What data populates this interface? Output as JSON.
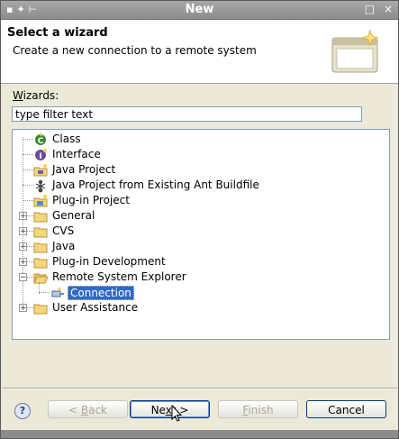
{
  "window": {
    "title": "New"
  },
  "header": {
    "title": "Select a wizard",
    "description": "Create a new connection to a remote system"
  },
  "wizards": {
    "label_mnemonic": "W",
    "label_rest": "izards:",
    "filter_value": "type filter text"
  },
  "tree": {
    "items": [
      {
        "label": "Class",
        "icon": "class-icon"
      },
      {
        "label": "Interface",
        "icon": "interface-icon"
      },
      {
        "label": "Java Project",
        "icon": "java-project-icon"
      },
      {
        "label": "Java Project from Existing Ant Buildfile",
        "icon": "ant-icon"
      },
      {
        "label": "Plug-in Project",
        "icon": "plugin-project-icon"
      },
      {
        "label": "General",
        "icon": "folder-icon"
      },
      {
        "label": "CVS",
        "icon": "folder-icon"
      },
      {
        "label": "Java",
        "icon": "folder-icon"
      },
      {
        "label": "Plug-in Development",
        "icon": "folder-icon"
      },
      {
        "label": "Remote System Explorer",
        "icon": "folder-open-icon"
      },
      {
        "label": "Connection",
        "icon": "connection-icon"
      },
      {
        "label": "User Assistance",
        "icon": "folder-icon"
      }
    ]
  },
  "buttons": {
    "back_mnemonic": "B",
    "back_rest": "ack",
    "back_prefix": "< ",
    "next_prefix": "Ne",
    "next_mnemonic": "x",
    "next_suffix": "t >",
    "finish_mnemonic": "F",
    "finish_rest": "inish",
    "cancel": "Cancel"
  }
}
